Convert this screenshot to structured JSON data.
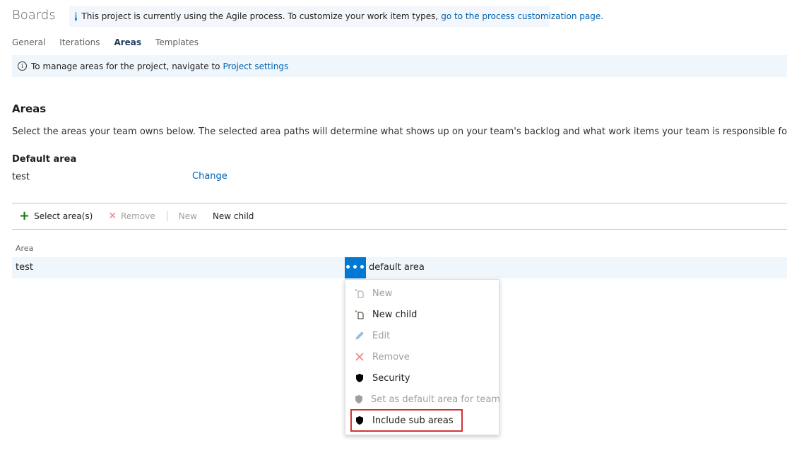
{
  "header": {
    "title": "Boards"
  },
  "process_banner": {
    "text": "This project is currently using the Agile process. To customize your work item types,",
    "link": "go to the process customization page."
  },
  "tabs": [
    {
      "label": "General",
      "active": false
    },
    {
      "label": "Iterations",
      "active": false
    },
    {
      "label": "Areas",
      "active": true
    },
    {
      "label": "Templates",
      "active": false
    }
  ],
  "manage_banner": {
    "text": "To manage areas for the project, navigate to",
    "link": "Project settings"
  },
  "areas_section": {
    "heading": "Areas",
    "description": "Select the areas your team owns below. The selected area paths will determine what shows up on your team's backlog and what work items your team is responsible for.",
    "default_label": "Default area",
    "default_value": "test",
    "change_link": "Change"
  },
  "toolbar": {
    "select_areas": "Select area(s)",
    "remove": "Remove",
    "new": "New",
    "new_child": "New child"
  },
  "table": {
    "column_header": "Area",
    "rows": [
      {
        "area": "test",
        "note": "default area"
      }
    ]
  },
  "context_menu": {
    "items": [
      {
        "label": "New",
        "icon": "new-icon",
        "disabled": true
      },
      {
        "label": "New child",
        "icon": "new-child-icon",
        "disabled": false
      },
      {
        "label": "Edit",
        "icon": "edit-icon",
        "disabled": true
      },
      {
        "label": "Remove",
        "icon": "remove-icon",
        "disabled": true
      },
      {
        "label": "Security",
        "icon": "shield-icon",
        "disabled": false
      },
      {
        "label": "Set as default area for team",
        "icon": "shield-icon",
        "disabled": true
      },
      {
        "label": "Include sub areas",
        "icon": "shield-icon",
        "disabled": false
      }
    ]
  },
  "colors": {
    "accent": "#0078d4",
    "link": "#0062b1",
    "highlight": "#d13438"
  }
}
